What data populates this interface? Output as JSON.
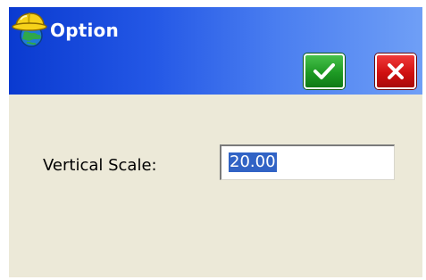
{
  "window": {
    "title": "Option",
    "app_icon": "helmet-globe-icon"
  },
  "toolbar": {
    "ok_icon": "checkmark-icon",
    "cancel_icon": "close-x-icon",
    "ok_color": "#1e9a24",
    "cancel_color": "#d01010"
  },
  "form": {
    "vertical_scale_label": "Vertical Scale:",
    "vertical_scale_value": "20.00"
  },
  "colors": {
    "titlebar_start": "#0a3ad0",
    "titlebar_end": "#6f9ff6",
    "body_background": "#ece9d8",
    "selection": "#3163c5"
  }
}
